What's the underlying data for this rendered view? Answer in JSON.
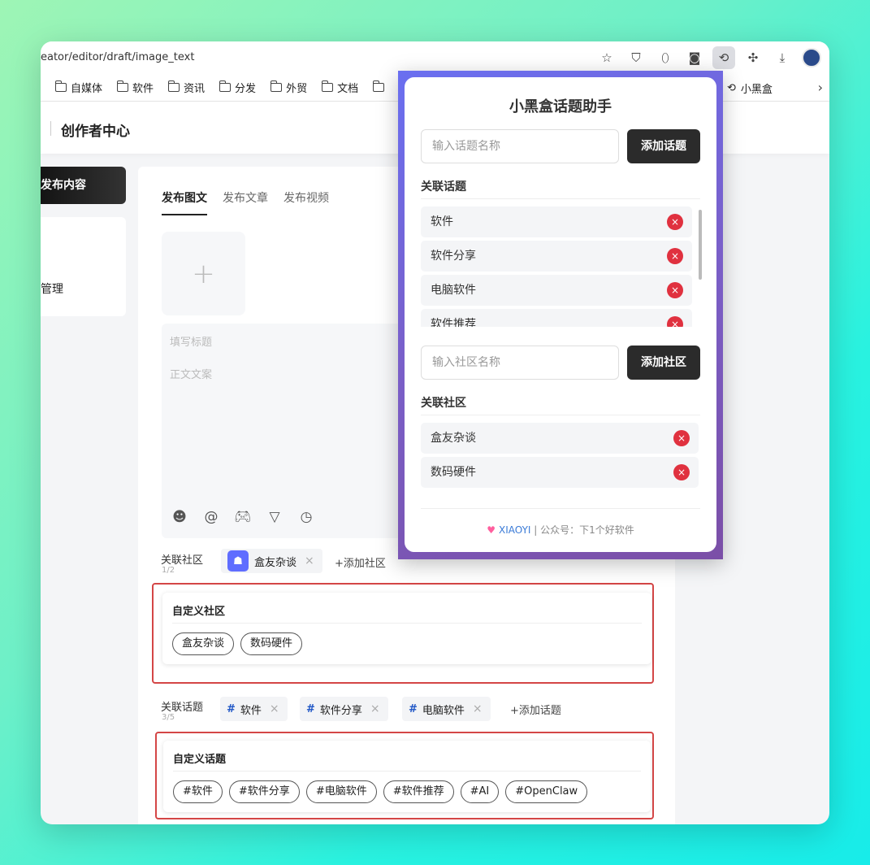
{
  "browser": {
    "address": "eator/editor/draft/image_text",
    "bookmarks": [
      "自媒体",
      "软件",
      "资讯",
      "分发",
      "外贸",
      "文档"
    ],
    "bookmark_right_label": "小黑盒",
    "icons": [
      "star-icon",
      "shield-icon",
      "ext-icon",
      "game-icon",
      "xiaoheihe-extension-icon",
      "puzzle-icon",
      "download-icon",
      "profile-avatar"
    ]
  },
  "app": {
    "title": "创作者中心",
    "publish_button": "发布内容",
    "manage_label": "管理"
  },
  "editor": {
    "tabs": [
      "发布图文",
      "发布文章",
      "发布视频"
    ],
    "upload_plus": "+",
    "title_placeholder": "填写标题",
    "body_placeholder": "正文文案",
    "tools": [
      "emoji-icon",
      "at-icon",
      "gamepad-icon",
      "vote-icon",
      "clock-icon"
    ]
  },
  "community": {
    "label": "关联社区",
    "count": "1/2",
    "selected": "盒友杂谈",
    "add_label": "+添加社区"
  },
  "custom_community": {
    "title": "自定义社区",
    "tags": [
      "盒友杂谈",
      "数码硬件"
    ]
  },
  "topics": {
    "label": "关联话题",
    "count": "3/5",
    "selected": [
      "软件",
      "软件分享",
      "电脑软件"
    ],
    "add_label": "+添加话题"
  },
  "custom_topics": {
    "title": "自定义话题",
    "tags": [
      "#软件",
      "#软件分享",
      "#电脑软件",
      "#软件推荐",
      "#AI",
      "#OpenClaw"
    ]
  },
  "popup": {
    "title": "小黑盒话题助手",
    "topic_placeholder": "输入话题名称",
    "add_topic_button": "添加话题",
    "topics_section": "关联话题",
    "topic_items": [
      "软件",
      "软件分享",
      "电脑软件",
      "软件推荐"
    ],
    "community_placeholder": "输入社区名称",
    "add_community_button": "添加社区",
    "community_section": "关联社区",
    "community_items": [
      "盒友杂谈",
      "数码硬件"
    ],
    "footer_brand": "XIAOYI",
    "footer_text": " | 公众号：下1个好软件",
    "delete_symbol": "×"
  },
  "colors": {
    "accent_dark": "#2b2b2b",
    "delete_red": "#e0313f",
    "highlight_frame": "#d44646",
    "popup_gradient_start": "#6a6ff0",
    "popup_gradient_end": "#7b4fa7"
  }
}
